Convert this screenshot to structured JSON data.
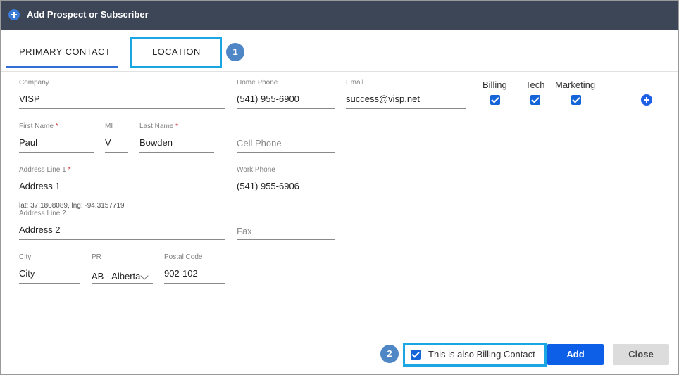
{
  "dialog": {
    "title": "Add Prospect or Subscriber"
  },
  "tabs": [
    {
      "label": "PRIMARY CONTACT",
      "active": true
    },
    {
      "label": "LOCATION",
      "active": false
    }
  ],
  "callouts": {
    "location": "1",
    "billing": "2"
  },
  "form": {
    "company": {
      "label": "Company",
      "value": "VISP"
    },
    "home_phone": {
      "label": "Home Phone",
      "value": "(541) 955-6900"
    },
    "email": {
      "label": "Email",
      "value": "success@visp.net"
    },
    "first_name": {
      "label": "First Name",
      "required_mark": "*",
      "value": "Paul"
    },
    "mi": {
      "label": "MI",
      "value": "V"
    },
    "last_name": {
      "label": "Last Name",
      "required_mark": "*",
      "value": "Bowden"
    },
    "cell_phone": {
      "placeholder": "Cell Phone",
      "value": ""
    },
    "address1": {
      "label": "Address Line 1",
      "required_mark": "*",
      "value": "Address 1"
    },
    "work_phone": {
      "label": "Work Phone",
      "value": "(541) 955-6906"
    },
    "latlng": "lat: 37.1808089, lng: -94.3157719",
    "address2": {
      "label": "Address Line 2",
      "value": "Address 2"
    },
    "fax": {
      "placeholder": "Fax",
      "value": ""
    },
    "city": {
      "label": "City",
      "value": "City"
    },
    "province": {
      "label": "PR",
      "value": "AB - Alberta"
    },
    "postal_code": {
      "label": "Postal Code",
      "value": "902-102"
    }
  },
  "contact_types": [
    {
      "label": "Billing",
      "checked": true
    },
    {
      "label": "Tech",
      "checked": true
    },
    {
      "label": "Marketing",
      "checked": true
    }
  ],
  "footer": {
    "billing_contact_label": "This is also Billing Contact",
    "billing_contact_checked": true,
    "add_label": "Add",
    "close_label": "Close"
  },
  "icons": {
    "title_icon": "plus-circle-icon",
    "add_contact_icon": "plus-circle-icon",
    "select_icon": "chevron-down-icon",
    "accent_color": "#0d5fe8",
    "titlebar_color": "#3d4656",
    "callout_color": "#1aa6e2"
  }
}
